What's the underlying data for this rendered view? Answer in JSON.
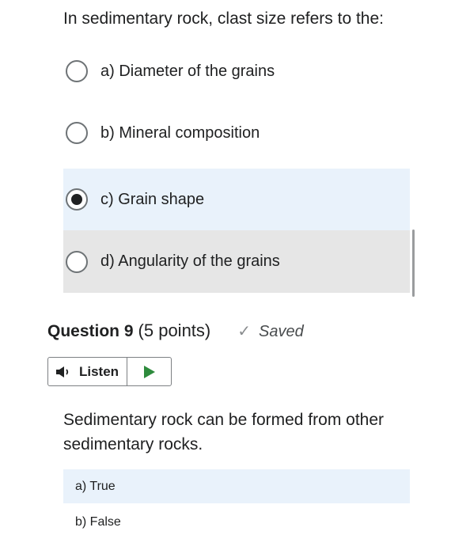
{
  "question8": {
    "prompt": "In sedimentary rock, clast size refers to the:",
    "options": [
      {
        "label": "a)  Diameter of the grains",
        "selected": false
      },
      {
        "label": "b)  Mineral composition",
        "selected": false
      },
      {
        "label": "c)  Grain shape",
        "selected": true
      },
      {
        "label": "d)  Angularity of the grains",
        "selected": false
      }
    ]
  },
  "question9": {
    "title": "Question 9",
    "points": "(5 points)",
    "status": "Saved",
    "status_icon": "check-icon",
    "listen_label": "Listen",
    "play_color": "#2e8b3d",
    "prompt": "Sedimentary rock can be formed from other sedimentary rocks.",
    "options": [
      {
        "label": "a) True",
        "selected": true
      },
      {
        "label": "b) False",
        "selected": false
      }
    ]
  },
  "colors": {
    "selected_bg": "#e9f2fb",
    "hover_bg": "#e6e6e6"
  }
}
